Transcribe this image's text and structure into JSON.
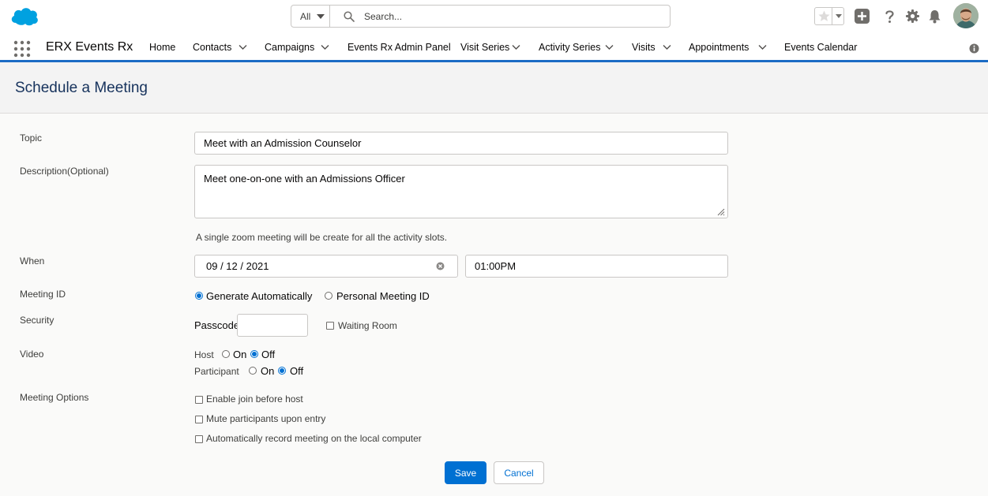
{
  "header": {
    "logo": "salesforce-cloud-logo",
    "search": {
      "scope_label": "All",
      "placeholder": "Search..."
    },
    "icons": [
      "star-icon",
      "plus-icon",
      "help-icon",
      "gear-icon",
      "bell-icon"
    ]
  },
  "nav": {
    "app_name": "ERX Events Rx",
    "items": [
      {
        "label": "Home",
        "has_menu": false
      },
      {
        "label": "Contacts",
        "has_menu": true
      },
      {
        "label": "Campaigns",
        "has_menu": true
      },
      {
        "label": "Events Rx Admin Panel",
        "has_menu": false
      },
      {
        "label": "Visit Series",
        "has_menu": true
      },
      {
        "label": "Activity Series",
        "has_menu": true
      },
      {
        "label": "Visits",
        "has_menu": true
      },
      {
        "label": "Appointments",
        "has_menu": true
      },
      {
        "label": "Events Calendar",
        "has_menu": false
      }
    ]
  },
  "page": {
    "title": "Schedule a Meeting"
  },
  "form": {
    "topic": {
      "label": "Topic",
      "value": "Meet with an Admission Counselor"
    },
    "description": {
      "label": "Description(Optional)",
      "value": "Meet one-on-one with an Admissions Officer"
    },
    "help_text": "A single zoom meeting will be create for all the activity slots.",
    "when": {
      "label": "When",
      "date": "09 / 12 / 2021",
      "time": "01:00PM"
    },
    "meeting_id": {
      "label": "Meeting ID",
      "options": [
        "Generate Automatically",
        "Personal Meeting ID"
      ],
      "selected": "Generate Automatically"
    },
    "security": {
      "label": "Security",
      "passcode_label": "Passcode",
      "passcode_value": "",
      "waiting_room_label": "Waiting Room",
      "waiting_room_checked": false
    },
    "video": {
      "label": "Video",
      "host": {
        "label": "Host",
        "on": "On",
        "off": "Off",
        "selected": "Off"
      },
      "participant": {
        "label": "Participant",
        "on": "On",
        "off": "Off",
        "selected": "Off"
      }
    },
    "meeting_options": {
      "label": "Meeting Options",
      "options": [
        {
          "label": "Enable join before host",
          "checked": false
        },
        {
          "label": "Mute participants upon entry",
          "checked": false
        },
        {
          "label": "Automatically record meeting on the local computer",
          "checked": false
        }
      ]
    },
    "buttons": {
      "save": "Save",
      "cancel": "Cancel"
    }
  },
  "colors": {
    "brand_blue": "#0070d2",
    "nav_underline": "#1b6bc4",
    "title_navy": "#16325c"
  }
}
